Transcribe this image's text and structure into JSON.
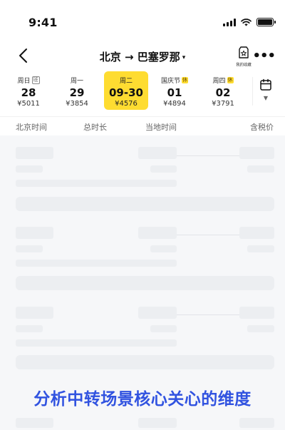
{
  "status_bar": {
    "time": "9:41"
  },
  "nav": {
    "title": "北京 → 巴塞罗那",
    "title_caret": "▾",
    "favorite_label": "我的收藏",
    "more": "•••"
  },
  "dates": [
    {
      "weekday": "周日",
      "tag": "班",
      "tag_type": "ban",
      "day": "28",
      "price": "¥5011",
      "selected": false
    },
    {
      "weekday": "周一",
      "tag": "",
      "tag_type": "",
      "day": "29",
      "price": "¥3854",
      "selected": false
    },
    {
      "weekday": "周二",
      "tag": "",
      "tag_type": "",
      "day": "09-30",
      "price": "¥4576",
      "selected": true
    },
    {
      "weekday": "国庆节",
      "tag": "休",
      "tag_type": "xiu",
      "day": "01",
      "price": "¥4894",
      "selected": false
    },
    {
      "weekday": "周四",
      "tag": "休",
      "tag_type": "xiu",
      "day": "02",
      "price": "¥3791",
      "selected": false
    }
  ],
  "columns": {
    "beijing_time": "北京时间",
    "total_duration": "总时长",
    "local_time": "当地时间",
    "tax_included": "含税价"
  },
  "caption": "分析中转场景核心关心的维度",
  "colors": {
    "accent_yellow": "#fedc31",
    "caption_blue": "#3153e0",
    "skeleton": "#eceef1",
    "list_bg": "#f6f7f9"
  },
  "icons": {
    "back": "back-chevron-icon",
    "favorite": "favorite-bag-icon",
    "more": "more-dots-icon",
    "calendar": "calendar-icon"
  }
}
